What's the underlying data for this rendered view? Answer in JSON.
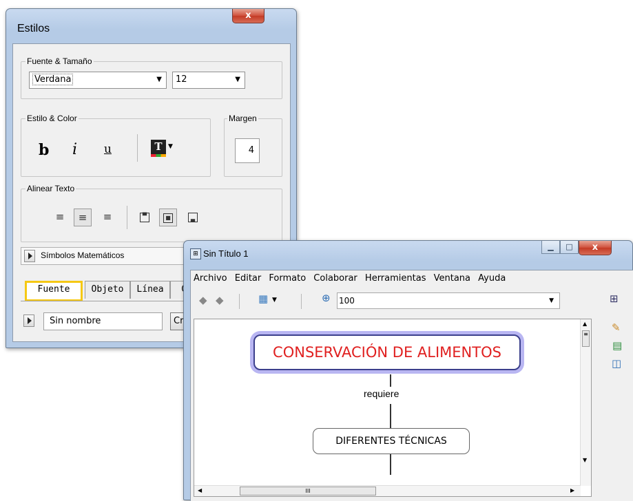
{
  "estilos": {
    "title": "Estilos",
    "close_glyph": "x",
    "font_group": {
      "label": "Fuente & Tamaño",
      "font_value": "Verdana",
      "size_value": "12"
    },
    "style_group": {
      "label": "Estilo & Color",
      "bold": "b",
      "italic": "i",
      "underline": "u",
      "color_icon": "text-color-icon"
    },
    "margin_group": {
      "label": "Margen",
      "value": "4"
    },
    "align_group": {
      "label": "Alinear Texto",
      "buttons": [
        "align-left",
        "align-center",
        "align-right",
        "valign-top",
        "valign-middle",
        "valign-bottom"
      ]
    },
    "math_symbols": "Símbolos Matemáticos",
    "tabs": [
      "Fuente",
      "Objeto",
      "Línea",
      "C"
    ],
    "style_name": "Sin nombre",
    "create_button": "Cr"
  },
  "mapwin": {
    "title": "Sin Título 1",
    "menu": [
      "Archivo",
      "Editar",
      "Formato",
      "Colaborar",
      "Herramientas",
      "Ventana",
      "Ayuda"
    ],
    "zoom": "100",
    "scroll_dots": "III",
    "nodes": {
      "main": "CONSERVACIÓN DE ALIMENTOS",
      "link": "requiere",
      "second": "DIFERENTES TÉCNICAS"
    },
    "colors": {
      "main_text": "#e02020",
      "main_border": "#3b3f8c",
      "main_glow": "#b9b6f2"
    }
  }
}
